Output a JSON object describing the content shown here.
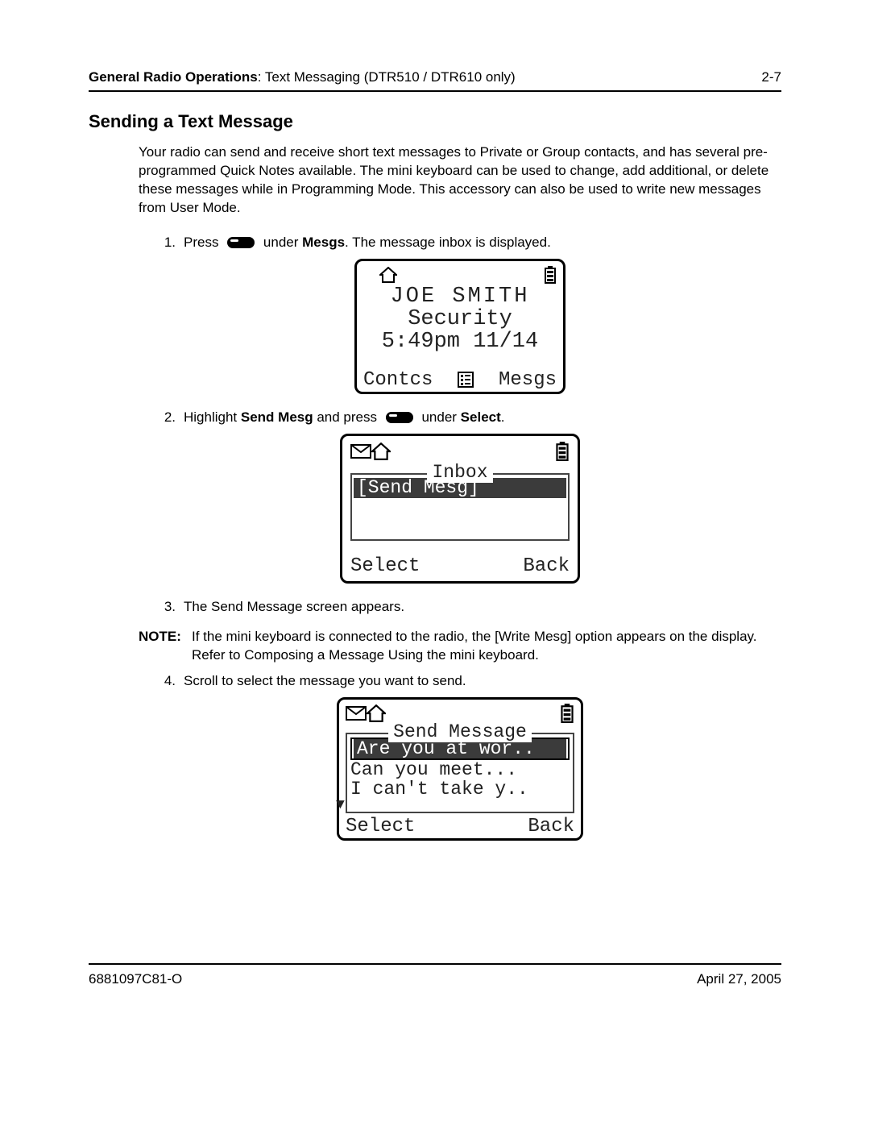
{
  "header": {
    "section_bold": "General Radio Operations",
    "section_rest": ": Text Messaging (DTR510 / DTR610 only)",
    "page_number": "2-7"
  },
  "section_title": "Sending a Text Message",
  "intro": "Your radio can send and receive short text messages to Private or Group contacts, and has several pre-programmed Quick Notes available. The mini keyboard can be used to change, add additional, or delete these messages while in Programming Mode. This accessory can also be used to write new messages from User Mode.",
  "steps": {
    "s1": {
      "num": "1.",
      "pre": "Press ",
      "under": " under ",
      "mesgs": "Mesgs",
      "post": ". The message inbox is displayed."
    },
    "s2": {
      "num": "2.",
      "pre": "Highlight ",
      "sendmesg": "Send Mesg",
      "mid": " and press ",
      "under": " under ",
      "select": "Select",
      "post": "."
    },
    "s3": {
      "num": "3.",
      "text": "The Send Message screen appears."
    },
    "s4": {
      "num": "4.",
      "text": "Scroll to select the message you want to send."
    }
  },
  "note": {
    "label": "NOTE:",
    "pre": "If the mini keyboard is connected to the radio, the ",
    "writemesg": "[Write Mesg]",
    "mid": " option appears on the display. Refer to Composing a Message Using the mini keyboard."
  },
  "lcd1": {
    "name": "JOE SMITH",
    "group": "Security",
    "time": "5:49pm 11/14",
    "left_soft": "Contcs",
    "right_soft": "Mesgs"
  },
  "lcd2": {
    "title": "Inbox",
    "item": "[Send Mesg]",
    "left_soft": "Select",
    "right_soft": "Back"
  },
  "lcd3": {
    "title": "Send Message",
    "opt1": "Are you at wor..",
    "opt2": "Can you meet...",
    "opt3": "I can't take y..",
    "left_soft": "Select",
    "right_soft": "Back"
  },
  "footer": {
    "docid": "6881097C81-O",
    "date": "April 27, 2005"
  }
}
